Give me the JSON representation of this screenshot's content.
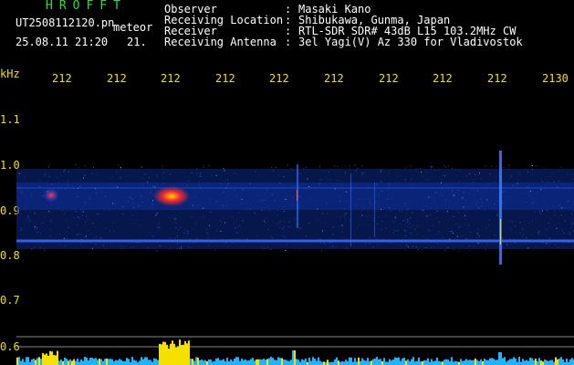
{
  "header": {
    "title": "HROFFT",
    "filename": "UT2508112120.pn",
    "mode": "meteor",
    "datetime": "25.08.11 21:20",
    "frame_no": "21.",
    "info": [
      {
        "label": "Observer",
        "value": "Masaki Kano"
      },
      {
        "label": "Receiving Location",
        "value": "Shibukawa, Gunma, Japan"
      },
      {
        "label": "Receiver",
        "value": "RTL-SDR SDR# 43dB L15 103.2MHz CW"
      },
      {
        "label": "Receiving Antenna",
        "value": "3el Yagi(V) Az 330 for Vladivostok"
      }
    ],
    "separator": ":"
  },
  "time_axis": {
    "ticks": [
      "212",
      "212",
      "212",
      "212",
      "212",
      "212",
      "212",
      "212",
      "212",
      "2130"
    ]
  },
  "freq_axis": {
    "unit": "kHz",
    "labels": [
      "1.1",
      "1.0",
      "0.9",
      "0.8",
      "0.7",
      "0.6"
    ]
  },
  "colors": {
    "background": "#000000",
    "header_title": "#33dd33",
    "header_text": "#ffffff",
    "axis_tick_text": "#f5e000",
    "noise_band": "#0b2a8a",
    "echo_hot": "#ff2a2a",
    "echo_warm": "#ffe000",
    "spectrum_fill": "#22b3ff",
    "spectrum_peak": "#f5e000"
  }
}
